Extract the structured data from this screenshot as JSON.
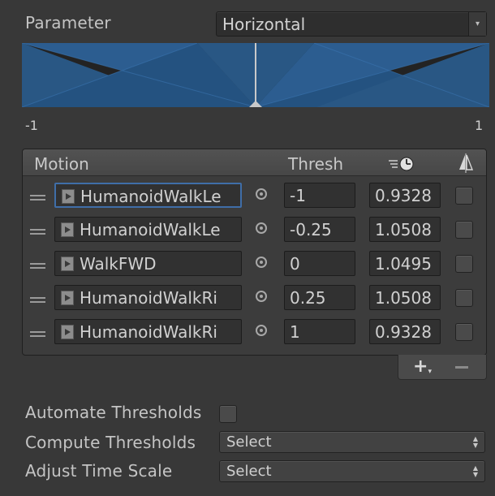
{
  "parameter": {
    "label": "Parameter",
    "value": "Horizontal"
  },
  "graph": {
    "min_label": "-1",
    "max_label": "1",
    "fill_color": "#2a5a8a",
    "background_color": "#232323",
    "selected_value": 0
  },
  "motion_list": {
    "headers": {
      "motion": "Motion",
      "thresh": "Thresh",
      "speed_icon": "time-scale-icon",
      "mirror_icon": "mirror-icon"
    },
    "rows": [
      {
        "clip": "HumanoidWalkLe",
        "thresh": "-1",
        "speed": "0.9328",
        "mirror": false
      },
      {
        "clip": "HumanoidWalkLe",
        "thresh": "-0.25",
        "speed": "1.0508",
        "mirror": false
      },
      {
        "clip": "WalkFWD",
        "thresh": "0",
        "speed": "1.0495",
        "mirror": false
      },
      {
        "clip": "HumanoidWalkRi",
        "thresh": "0.25",
        "speed": "1.0508",
        "mirror": false
      },
      {
        "clip": "HumanoidWalkRi",
        "thresh": "1",
        "speed": "0.9328",
        "mirror": false
      }
    ],
    "add_label": "+",
    "add_suffix": "▾"
  },
  "automate_threshold": {
    "label": "Automate Thresholds",
    "checked": false
  },
  "compute_thresholds": {
    "label": "Compute Thresholds",
    "value": "Select"
  },
  "adjust_time_scale": {
    "label": "Adjust Time Scale",
    "value": "Select"
  }
}
